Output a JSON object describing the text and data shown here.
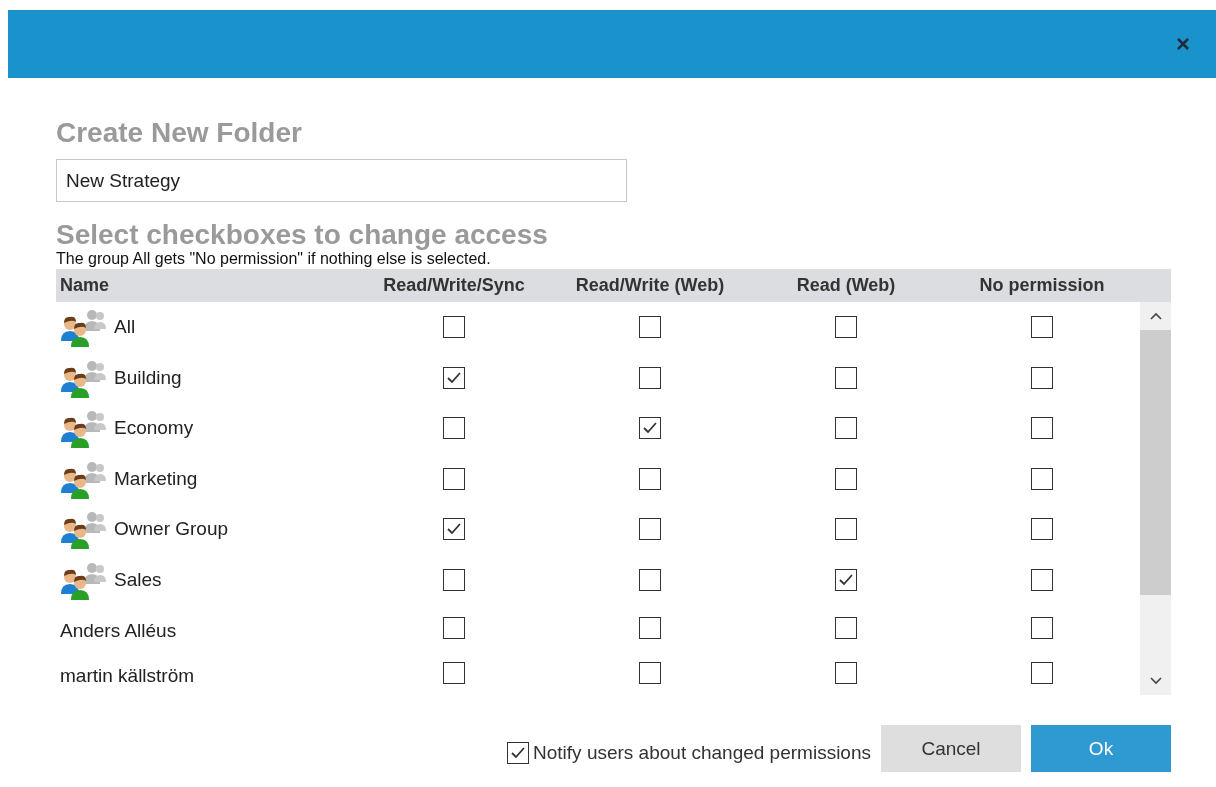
{
  "dialog": {
    "close": "×"
  },
  "title": "Create New Folder",
  "folder_name": {
    "value": "New Strategy"
  },
  "access_heading": "Select checkboxes to change access",
  "note": "The group All gets \"No permission\" if nothing else is selected.",
  "table": {
    "columns": [
      "Name",
      "Read/Write/Sync",
      "Read/Write (Web)",
      "Read (Web)",
      "No permission"
    ],
    "rows": [
      {
        "kind": "group",
        "name": "All",
        "checked": [
          false,
          false,
          false,
          false
        ]
      },
      {
        "kind": "group",
        "name": "Building",
        "checked": [
          true,
          false,
          false,
          false
        ]
      },
      {
        "kind": "group",
        "name": "Economy",
        "checked": [
          false,
          true,
          false,
          false
        ]
      },
      {
        "kind": "group",
        "name": "Marketing",
        "checked": [
          false,
          false,
          false,
          false
        ]
      },
      {
        "kind": "group",
        "name": "Owner Group",
        "checked": [
          true,
          false,
          false,
          false
        ]
      },
      {
        "kind": "group",
        "name": "Sales",
        "checked": [
          false,
          false,
          true,
          false
        ]
      },
      {
        "kind": "user",
        "name": "Anders Alléus",
        "checked": [
          false,
          false,
          false,
          false
        ]
      },
      {
        "kind": "user",
        "name": "martin källström",
        "checked": [
          false,
          false,
          false,
          false
        ]
      }
    ]
  },
  "notify": {
    "label": "Notify users about changed permissions",
    "checked": true
  },
  "buttons": [
    {
      "label": "Cancel",
      "kind": "secondary"
    },
    {
      "label": "Ok",
      "kind": "primary"
    }
  ]
}
